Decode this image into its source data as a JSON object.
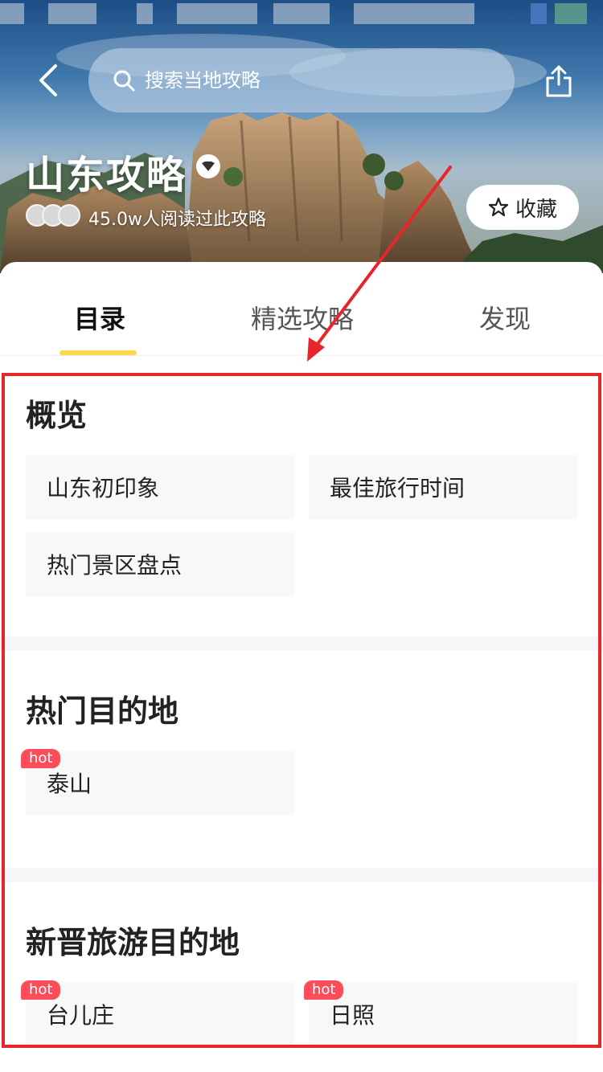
{
  "header": {
    "search_placeholder": "搜索当地攻略",
    "title": "山东攻略",
    "read_count": "45.0w人阅读过此攻略",
    "favorite_label": "收藏"
  },
  "tabs": [
    {
      "label": "目录",
      "active": true
    },
    {
      "label": "精选攻略",
      "active": false
    },
    {
      "label": "发现",
      "active": false
    }
  ],
  "sections": [
    {
      "title": "概览",
      "items": [
        {
          "label": "山东初印象"
        },
        {
          "label": "最佳旅行时间"
        },
        {
          "label": "热门景区盘点"
        }
      ]
    },
    {
      "title": "热门目的地",
      "items": [
        {
          "label": "泰山",
          "badge": "hot"
        }
      ]
    },
    {
      "title": "新晋旅游目的地",
      "items": [
        {
          "label": "台儿庄",
          "badge": "hot"
        },
        {
          "label": "日照",
          "badge": "hot"
        }
      ]
    }
  ],
  "colors": {
    "tab_indicator": "#ffd74a",
    "hot_badge": "#ff4c5a",
    "annotation": "#e8262a",
    "chip_bg": "#f8f8f8"
  },
  "icons": [
    "back-arrow-icon",
    "search-icon",
    "share-icon",
    "verified-icon",
    "star-icon"
  ]
}
